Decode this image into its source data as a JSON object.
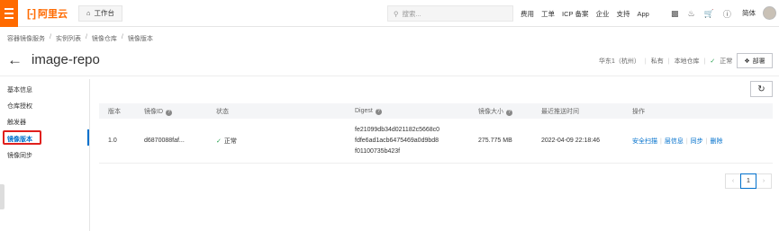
{
  "topbar": {
    "logo_text": "阿里云",
    "workbench_label": "工作台",
    "search_placeholder": "搜索...",
    "nav": [
      "费用",
      "工单",
      "ICP 备案",
      "企业",
      "支持",
      "App"
    ],
    "lang": "简体"
  },
  "breadcrumb": [
    "容器镜像服务",
    "实例列表",
    "镜像仓库",
    "镜像版本"
  ],
  "title": "image-repo",
  "meta": {
    "region": "华东1（杭州）",
    "visibility": "私有",
    "source": "本地仓库",
    "status": "正常"
  },
  "deploy_label": "部署",
  "sidebar": {
    "items": [
      {
        "label": "基本信息"
      },
      {
        "label": "仓库授权"
      },
      {
        "label": "触发器"
      },
      {
        "label": "镜像版本"
      },
      {
        "label": "镜像同步"
      }
    ]
  },
  "table": {
    "headers": [
      "版本",
      "镜像ID",
      "状态",
      "Digest",
      "镜像大小",
      "最近推送时间",
      "操作"
    ],
    "row": {
      "version": "1.0",
      "image_id": "d6870088faf...",
      "status": "正常",
      "digest_1": "fe21099db34d021182c5668c0",
      "digest_2": "fdfe6ad1acb6475469a0d9bd8",
      "digest_3": "f01100735b423f",
      "size": "275.775 MB",
      "pushed": "2022-04-09 22:18:46",
      "actions": [
        "安全扫描",
        "层信息",
        "同步",
        "删除"
      ]
    }
  },
  "pager": {
    "current": "1"
  },
  "colors": {
    "accent": "#ff6a00",
    "link": "#0070cc",
    "ok": "#2aa150",
    "highlight": "#e0201d"
  }
}
